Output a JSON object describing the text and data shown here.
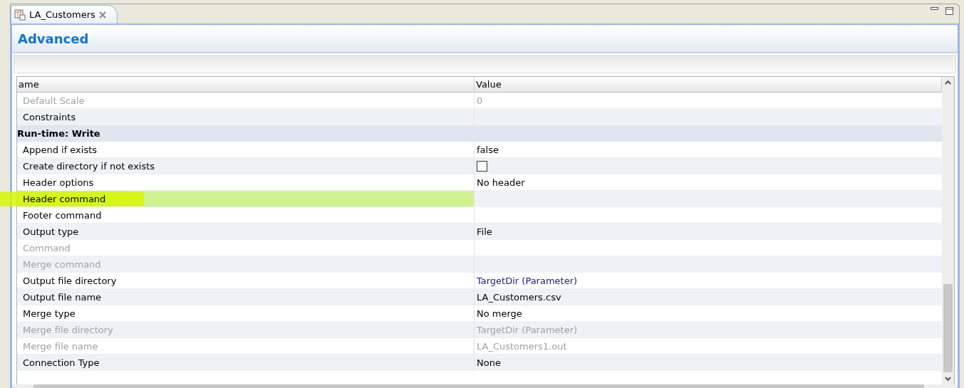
{
  "tab": {
    "title": "LA_Customers",
    "selected": true
  },
  "section_title": "Advanced",
  "table": {
    "columns": [
      "ame",
      "Value"
    ],
    "rows": [
      {
        "kind": "property",
        "name": "Default Scale",
        "value": "0",
        "disabled": true
      },
      {
        "kind": "property",
        "name": "Constraints",
        "disabled": false
      },
      {
        "kind": "group",
        "name": "Run-time: Write"
      },
      {
        "kind": "property",
        "name": "Append if exists",
        "value": "false",
        "disabled": false
      },
      {
        "kind": "checkbox",
        "name": "Create directory if not exists",
        "checked": false,
        "disabled": false
      },
      {
        "kind": "property",
        "name": "Header options",
        "value": "No header",
        "disabled": false
      },
      {
        "kind": "property",
        "name": "Header command",
        "disabled": false,
        "highlighted": true
      },
      {
        "kind": "property",
        "name": "Footer command",
        "disabled": false
      },
      {
        "kind": "property",
        "name": "Output type",
        "value": "File",
        "disabled": false
      },
      {
        "kind": "property",
        "name": "Command",
        "disabled": true
      },
      {
        "kind": "property",
        "name": "Merge command",
        "disabled": true
      },
      {
        "kind": "parameter",
        "name": "Output file directory",
        "value": "TargetDir (Parameter)",
        "disabled": false
      },
      {
        "kind": "property",
        "name": "Output file name",
        "value": "LA_Customers.csv",
        "disabled": false
      },
      {
        "kind": "property",
        "name": "Merge type",
        "value": "No merge",
        "disabled": false
      },
      {
        "kind": "parameter",
        "name": "Merge file directory",
        "value": "TargetDir (Parameter)",
        "disabled": true
      },
      {
        "kind": "property",
        "name": "Merge file name",
        "value": "LA_Customers1.out",
        "disabled": true
      },
      {
        "kind": "property",
        "name": "Connection Type",
        "value": "None",
        "disabled": false
      }
    ]
  }
}
